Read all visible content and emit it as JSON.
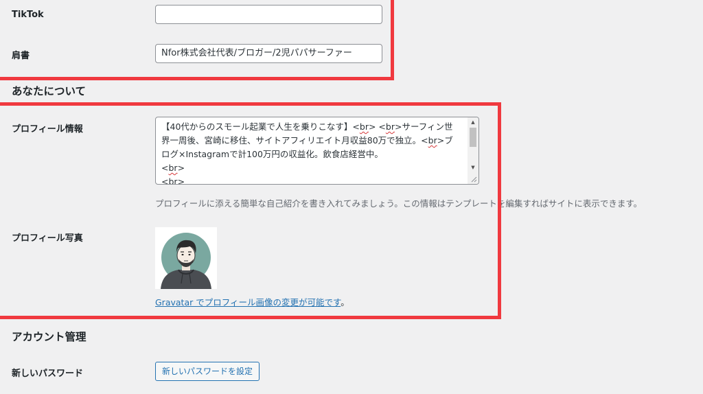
{
  "social": {
    "tiktok_label": "TikTok",
    "tiktok_value": ""
  },
  "title_field": {
    "label": "肩書",
    "value": "Nfor株式会社代表/ブロガー/2児パパサーファー"
  },
  "about_section": {
    "heading": "あなたについて"
  },
  "profile_info": {
    "label": "プロフィール情報",
    "bio_lines": [
      [
        "【40代からのスモール起業で人生を乗りこなす】<",
        "br",
        "> <",
        "br",
        ">サーフィン世"
      ],
      [
        "界一周後、宮崎に移住、サイトアフィリエイト月収益80万で独立。<",
        "br",
        ">ブ"
      ],
      [
        "ログ×Instagramで計100万円の収益化。飲食店経営中。"
      ],
      [
        "<",
        "br",
        ">"
      ],
      [
        "<",
        "br",
        ">"
      ]
    ],
    "description": "プロフィールに添える簡単な自己紹介を書き入れてみましょう。この情報はテンプレートを編集すればサイトに表示できます。"
  },
  "profile_photo": {
    "label": "プロフィール写真",
    "gravatar_link": "Gravatar でプロフィール画像の変更が可能です",
    "gravatar_suffix": "。"
  },
  "account_section": {
    "heading": "アカウント管理",
    "password_label": "新しいパスワード",
    "password_button": "新しいパスワードを設定"
  },
  "colors": {
    "highlight": "#f0393f",
    "background": "#f0f0f1",
    "link": "#2271b1"
  }
}
